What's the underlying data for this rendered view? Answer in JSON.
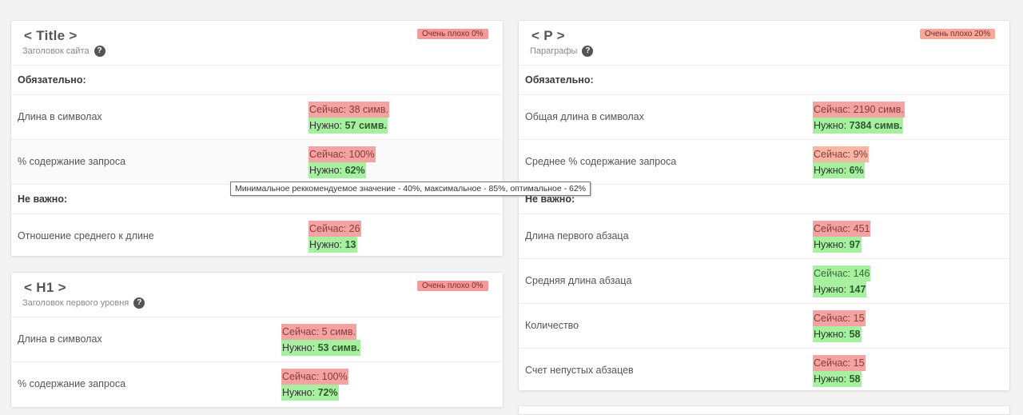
{
  "title_card": {
    "title": "< Title >",
    "subtitle": "Заголовок сайта",
    "badge": "Очень плохо 0%",
    "required_label": "Обязательно:",
    "not_important_label": "Не важно:",
    "rows": [
      {
        "label": "Длина в символах",
        "now": "Сейчас: 38 симв.",
        "need_prefix": "Нужно: ",
        "need_value": "57 симв."
      },
      {
        "label": "% содержание запроса",
        "now": "Сейчас: 100%",
        "need_prefix": "Нужно: ",
        "need_value": "62%"
      },
      {
        "label": "Отношение среднего к длине",
        "now": "Сейчас: 26",
        "need_prefix": "Нужно: ",
        "need_value": "13"
      }
    ]
  },
  "h1_card": {
    "title": "< H1 >",
    "subtitle": "Заголовок первого уровня",
    "badge": "Очень плохо 0%",
    "rows": [
      {
        "label": "Длина в символах",
        "now": "Сейчас: 5 симв.",
        "need_prefix": "Нужно: ",
        "need_value": "53 симв."
      },
      {
        "label": "% содержание запроса",
        "now": "Сейчас: 100%",
        "need_prefix": "Нужно: ",
        "need_value": "72%"
      }
    ]
  },
  "p_card": {
    "title": "< P >",
    "subtitle": "Параграфы",
    "badge": "Очень плохо 20%",
    "required_label": "Обязательно:",
    "not_important_label": "Не важно:",
    "rows": [
      {
        "label": "Общая длина в символах",
        "now": "Сейчас: 2190 симв.",
        "need_prefix": "Нужно: ",
        "need_value": "7384 симв."
      },
      {
        "label": "Среднее % содержание запроса",
        "now": "Сейчас: 9%",
        "need_prefix": "Нужно: ",
        "need_value": "6%"
      },
      {
        "label": "Длина первого абзаца",
        "now": "Сейчас: 451",
        "need_prefix": "Нужно: ",
        "need_value": "97"
      },
      {
        "label": "Средняя длина абзаца",
        "now": "Сейчас: 146",
        "need_prefix": "Нужно: ",
        "need_value": "147"
      },
      {
        "label": "Количество",
        "now": "Сейчас: 15",
        "need_prefix": "Нужно: ",
        "need_value": "58"
      },
      {
        "label": "Счет непустых абзацев",
        "now": "Сейчас: 15",
        "need_prefix": "Нужно: ",
        "need_value": "58"
      }
    ]
  },
  "tooltip": "Минимальное реккомендуемое значение - 40%, максимальное - 85%,  оптимальное - 62%",
  "help_icon_glyph": "?",
  "colors": {
    "bad": "#f4a3a3",
    "warn": "#f7b5a3",
    "good": "#a7f0a0"
  }
}
